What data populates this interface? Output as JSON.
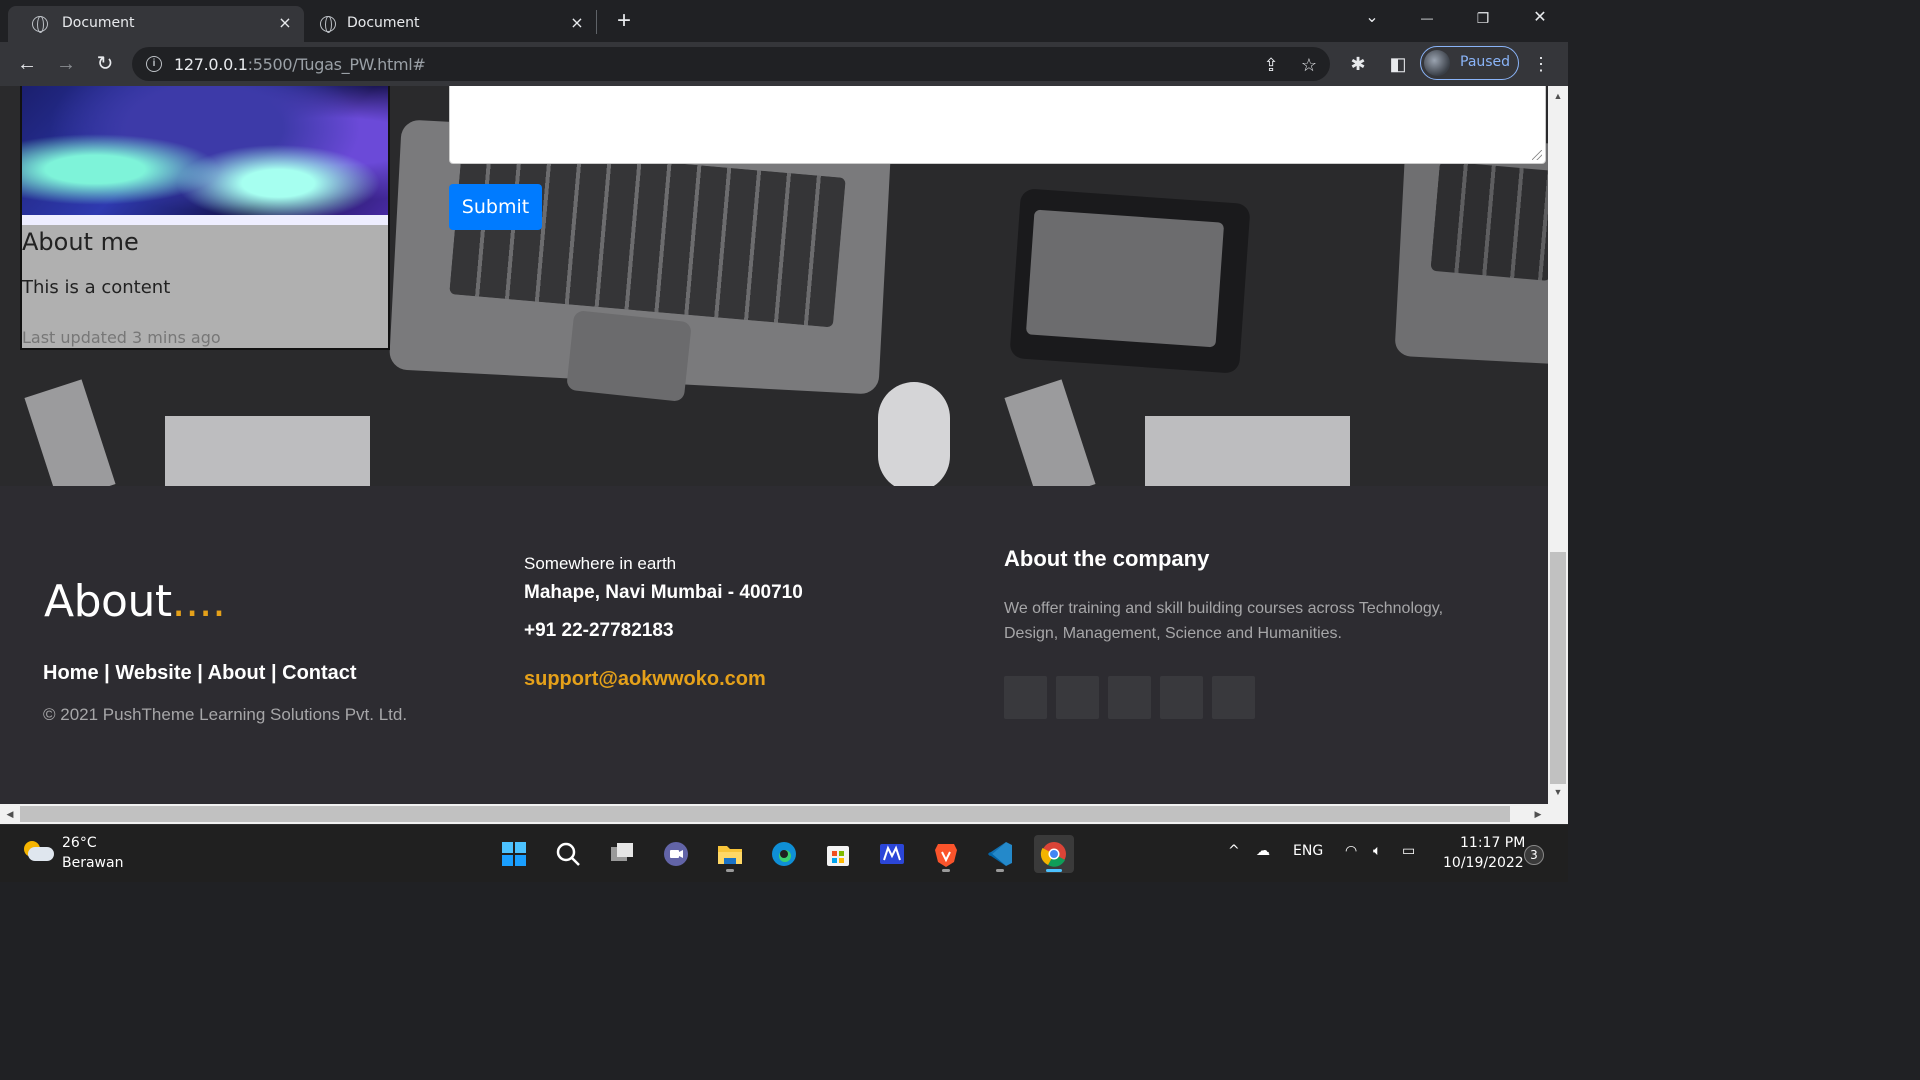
{
  "browser": {
    "tabs": [
      {
        "title": "Document",
        "active": true
      },
      {
        "title": "Document",
        "active": false
      }
    ],
    "url_host": "127.0.0.1",
    "url_rest": ":5500/Tugas_PW.html#",
    "profile_label": "Paused",
    "icons": {
      "tab_close": "×",
      "new_tab": "+",
      "tab_search": "⌄",
      "minimize": "—",
      "restore": "❐",
      "close": "✕",
      "back": "←",
      "forward": "→",
      "reload": "↻",
      "info": "i",
      "share": "⇪",
      "bookmark": "☆",
      "extensions": "✱",
      "sidebar": "◧",
      "menu": "⋮"
    }
  },
  "page": {
    "card": {
      "title": "About me",
      "text": "This is a content",
      "muted": "Last updated 3 mins ago"
    },
    "form": {
      "submit_label": "Submit"
    },
    "footer": {
      "about_title": "About",
      "about_dots": "....",
      "links": [
        "Home",
        "Website",
        "About",
        "Contact"
      ],
      "link_separator": "|",
      "copyright": "© 2021 PushTheme Learning Solutions Pvt. Ltd.",
      "address_line1": "Somewhere in earth",
      "address_line2": "Mahape, Navi Mumbai - 400710",
      "phone": "+91 22-27782183",
      "email": "support@aokwwoko.com",
      "company_title": "About the company",
      "company_text": "We offer training and skill building courses across Technology, Design, Management, Science and Humanities.",
      "social_count": 5
    },
    "colors": {
      "accent": "#e5a11a",
      "button": "#007bff",
      "footer_bg": "#2d2c31"
    }
  },
  "taskbar": {
    "weather_temp": "26°C",
    "weather_desc": "Berawan",
    "apps": [
      "windows-start",
      "search",
      "task-view",
      "chat",
      "file-explorer",
      "edge",
      "microsoft-store",
      "markdown-editor",
      "brave",
      "vscode",
      "chrome"
    ],
    "tray_chevron": "^",
    "language": "ENG",
    "time": "11:17 PM",
    "date": "10/19/2022",
    "notification_count": "3"
  }
}
